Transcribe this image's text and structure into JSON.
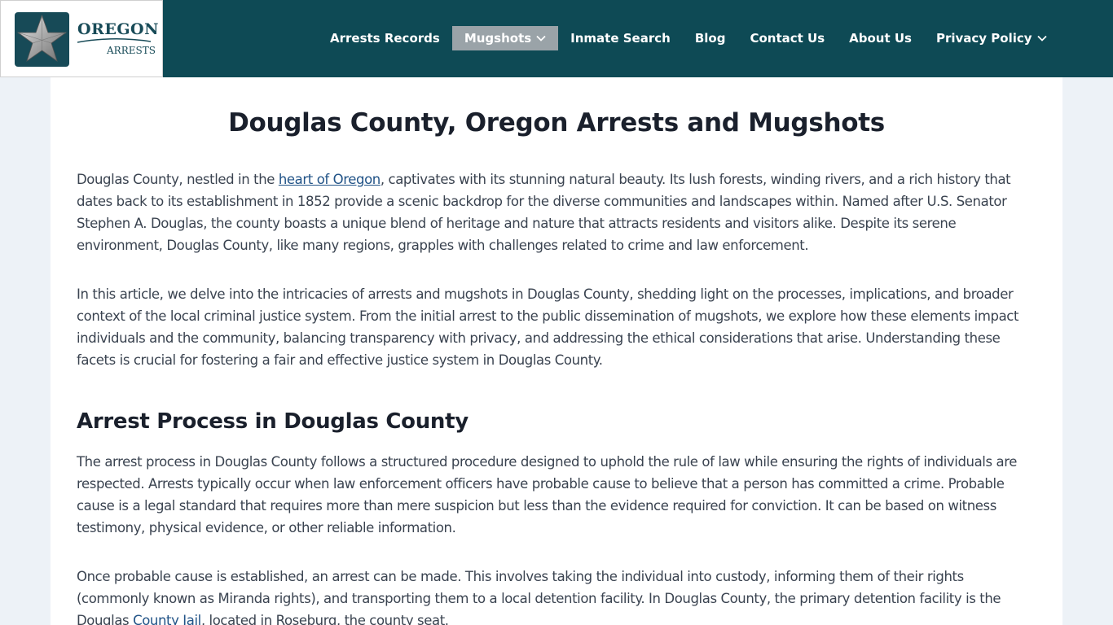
{
  "logo": {
    "title": "OREGON",
    "subtitle": "ARRESTS",
    "icon": "star-icon"
  },
  "nav": {
    "items": [
      {
        "label": "Arrests Records"
      },
      {
        "label": "Mugshots"
      },
      {
        "label": "Inmate Search"
      },
      {
        "label": "Blog"
      },
      {
        "label": "Contact Us"
      },
      {
        "label": "About Us"
      },
      {
        "label": "Privacy Policy"
      }
    ]
  },
  "colors": {
    "header_bg": "#0e4a55",
    "active_nav_bg": "#9aa3a8",
    "link": "#215387",
    "page_bg": "#edf2f7"
  },
  "article": {
    "title": "Douglas County, Oregon Arrests and Mugshots",
    "p1": {
      "before": "Douglas County, nestled in the ",
      "link": "heart of Oregon",
      "after": ", captivates with its stunning natural beauty. Its lush forests, winding rivers, and a rich history that dates back to its establishment in 1852 provide a scenic backdrop for the diverse communities and landscapes within. Named after U.S. Senator Stephen A. Douglas, the county boasts a unique blend of heritage and nature that attracts residents and visitors alike. Despite its serene environment, Douglas County, like many regions, grapples with challenges related to crime and law enforcement."
    },
    "p2": "In this article, we delve into the intricacies of arrests and mugshots in Douglas County, shedding light on the processes, implications, and broader context of the local criminal justice system. From the initial arrest to the public dissemination of mugshots, we explore how these elements impact individuals and the community, balancing transparency with privacy, and addressing the ethical considerations that arise. Understanding these facets is crucial for fostering a fair and effective justice system in Douglas County.",
    "h2": "Arrest Process in Douglas County",
    "p3": "The arrest process in Douglas County follows a structured procedure designed to uphold the rule of law while ensuring the rights of individuals are respected. Arrests typically occur when law enforcement officers have probable cause to believe that a person has committed a crime. Probable cause is a legal standard that requires more than mere suspicion but less than the evidence required for conviction. It can be based on witness testimony, physical evidence, or other reliable information.",
    "p4": {
      "before": "Once probable cause is established, an arrest can be made. This involves taking the individual into custody, informing them of their rights (commonly known as Miranda rights), and transporting them to a local detention facility. In Douglas County, the primary detention facility is the Douglas ",
      "link": "County Jail",
      "after": ", located in Roseburg, the county seat."
    }
  }
}
